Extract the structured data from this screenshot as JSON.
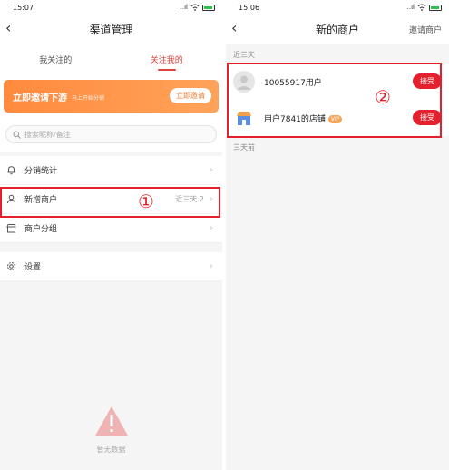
{
  "left": {
    "status": {
      "time": "15:07",
      "signal": "..ıl",
      "battery": "100"
    },
    "nav": {
      "back": "‹",
      "title": "渠道管理"
    },
    "tabs": [
      {
        "label": "我关注的"
      },
      {
        "label": "关注我的"
      }
    ],
    "banner": {
      "title": "立即邀请下游",
      "subtitle": "马上开始分销",
      "button": "立即邀请"
    },
    "search": {
      "placeholder": "搜索昵称/备注"
    },
    "menu": [
      {
        "label": "分销统计",
        "extra": ""
      },
      {
        "label": "新增商户",
        "extra": "近三天 2"
      },
      {
        "label": "商户分组",
        "extra": ""
      },
      {
        "label": "设置",
        "extra": ""
      }
    ],
    "annotation": "①",
    "empty": {
      "text": "暂无数据"
    }
  },
  "right": {
    "status": {
      "time": "15:06",
      "signal": "..ıl",
      "battery": "100"
    },
    "nav": {
      "back": "‹",
      "title": "新的商户",
      "action": "邀请商户"
    },
    "sections": [
      {
        "label": "近三天"
      },
      {
        "label": "三天前"
      }
    ],
    "merchants": [
      {
        "name": "10055917用户",
        "vip": "",
        "button": "接受"
      },
      {
        "name": "用户7841的店铺",
        "vip": "VIP",
        "button": "接受"
      }
    ],
    "annotation": "②"
  },
  "colors": {
    "accent": "#e3202b",
    "tab_active": "#e0413c",
    "banner_start": "#ff8a3d",
    "banner_end": "#ffa35a"
  }
}
